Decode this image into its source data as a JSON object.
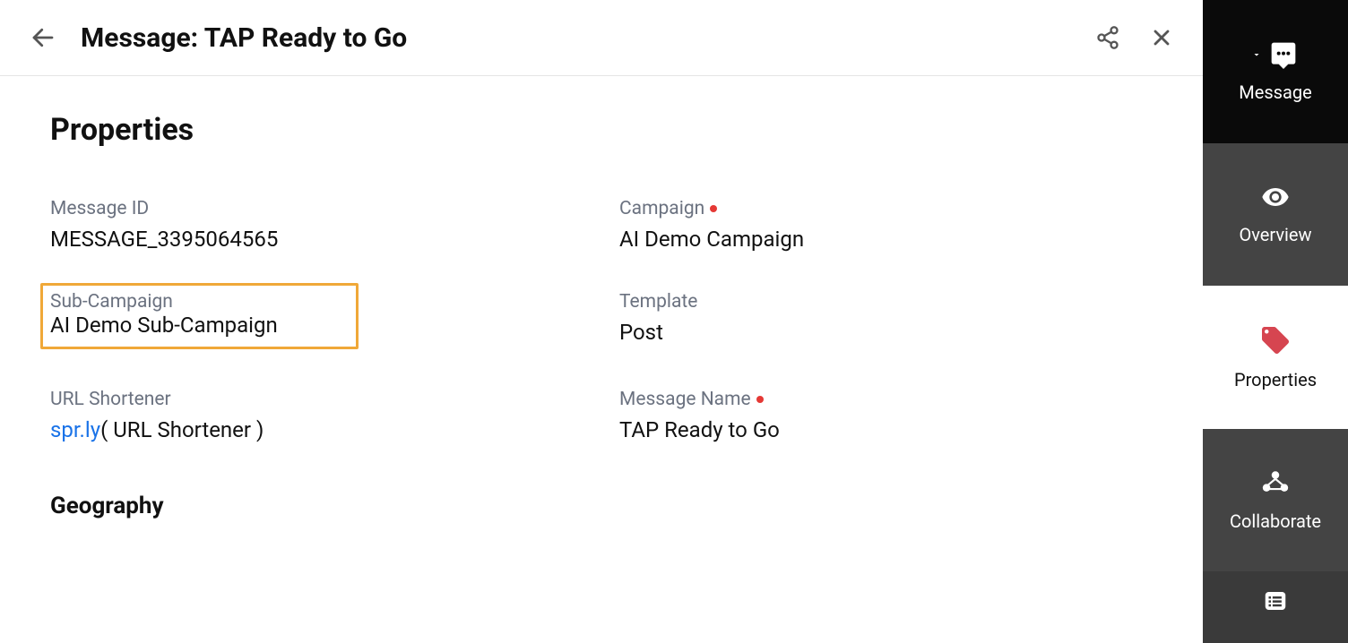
{
  "header": {
    "title": "Message: TAP Ready to Go"
  },
  "section": {
    "title": "Properties"
  },
  "properties": {
    "messageId": {
      "label": "Message ID",
      "value": "MESSAGE_3395064565"
    },
    "campaign": {
      "label": "Campaign",
      "value": "AI Demo Campaign"
    },
    "subCampaign": {
      "label": "Sub-Campaign",
      "value": "AI Demo Sub-Campaign"
    },
    "template": {
      "label": "Template",
      "value": "Post"
    },
    "urlShortener": {
      "label": "URL Shortener",
      "link": "spr.ly",
      "extra": "( URL Shortener )"
    },
    "messageName": {
      "label": "Message Name",
      "value": "TAP Ready to Go"
    }
  },
  "subsection": {
    "title": "Geography"
  },
  "sidebar": {
    "message": "Message",
    "overview": "Overview",
    "properties": "Properties",
    "collaborate": "Collaborate"
  }
}
